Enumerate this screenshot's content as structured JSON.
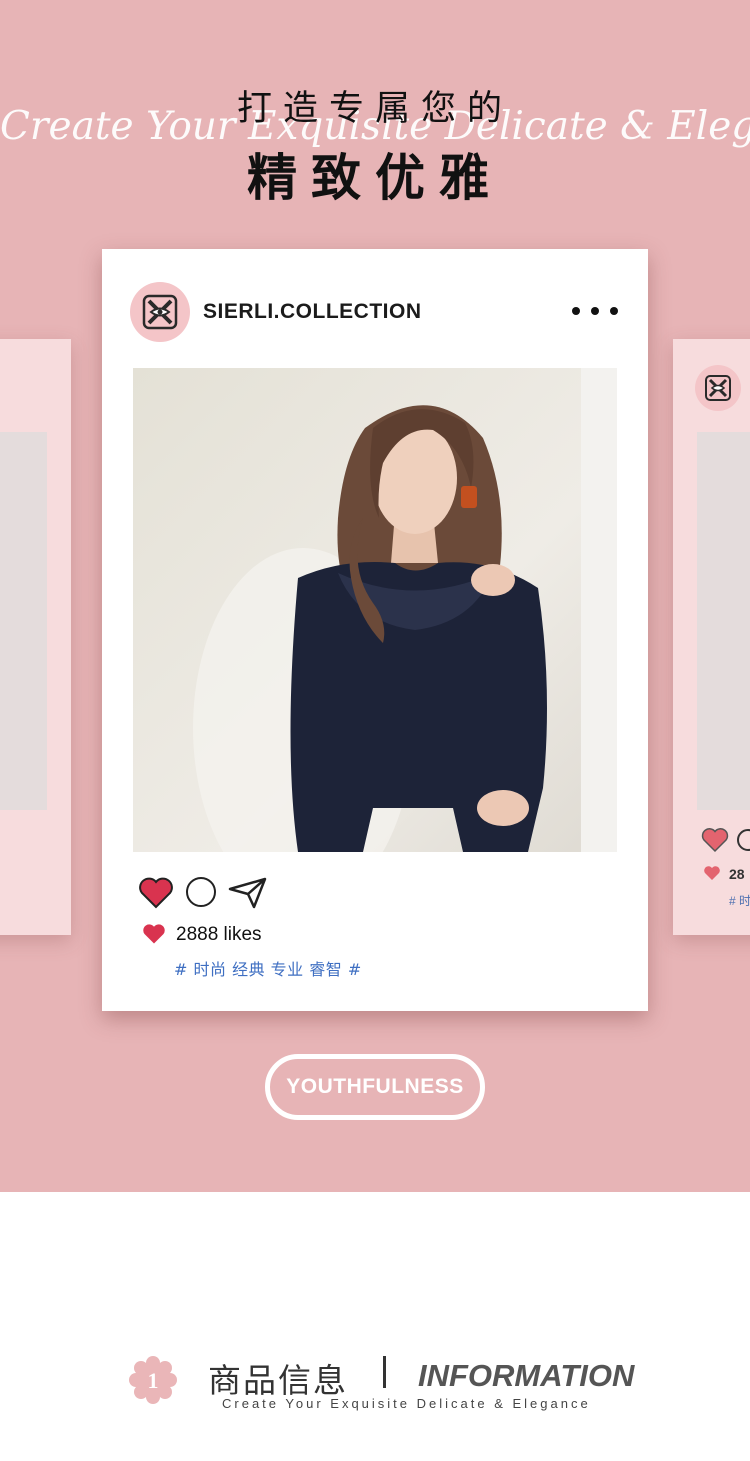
{
  "banner": {
    "headline_top": "打造专属您的",
    "headline_script": "Create Your Exquisite Delicate & Elegance",
    "headline_main": "精致优雅",
    "background_color": "#e7b4b6"
  },
  "post": {
    "account_name": "SIERLI.COLLECTION",
    "likes_text": "2888 likes",
    "tags": "# 时尚 经典 专业 睿智 #",
    "tag_color": "#3f6fc2",
    "heart_color": "#d9334f",
    "icons": [
      "heart-icon",
      "comment-icon",
      "share-icon",
      "more-icon"
    ]
  },
  "side_card_right": {
    "likes_text": "28",
    "tags": "# 时"
  },
  "cta": {
    "label": "YOUTHFULNESS"
  },
  "section": {
    "badge_number": "1",
    "title_cn": "商品信息",
    "title_en": "INFORMATION",
    "subtitle": "Create Your Exquisite Delicate & Elegance"
  }
}
